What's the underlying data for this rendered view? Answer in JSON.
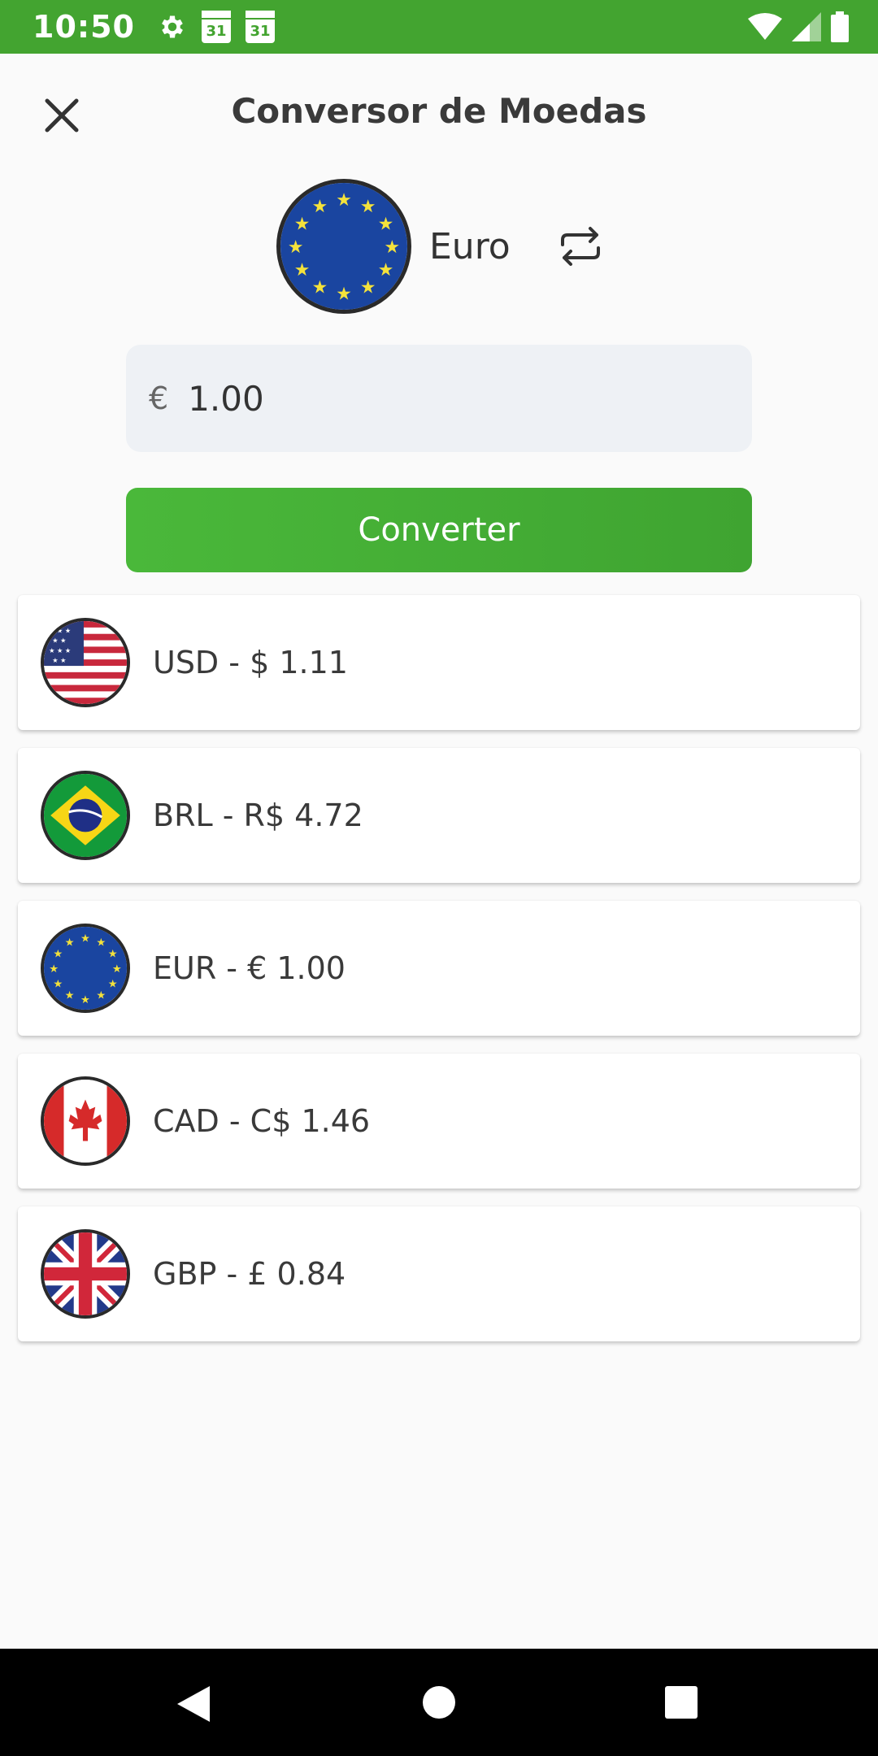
{
  "status_bar": {
    "time": "10:50",
    "calendar_day_1": "31",
    "calendar_day_2": "31"
  },
  "header": {
    "title": "Conversor de Moedas",
    "close_icon": "close-icon"
  },
  "selector": {
    "currency_name": "Euro",
    "flag_icon": "eu-flag-icon",
    "swap_icon": "swap-icon"
  },
  "amount": {
    "symbol": "€",
    "value": "1.00"
  },
  "convert_button": {
    "label": "Converter"
  },
  "results": [
    {
      "label": "USD - $ 1.11",
      "flag": "us-flag-icon"
    },
    {
      "label": "BRL - R$ 4.72",
      "flag": "br-flag-icon"
    },
    {
      "label": "EUR - € 1.00",
      "flag": "eu-flag-icon"
    },
    {
      "label": "CAD - C$ 1.46",
      "flag": "ca-flag-icon"
    },
    {
      "label": "GBP - £ 0.84",
      "flag": "gb-flag-icon"
    }
  ],
  "colors": {
    "status_bar": "#43a430",
    "accent": "#4ab83a",
    "input_bg": "#eef1f5"
  }
}
